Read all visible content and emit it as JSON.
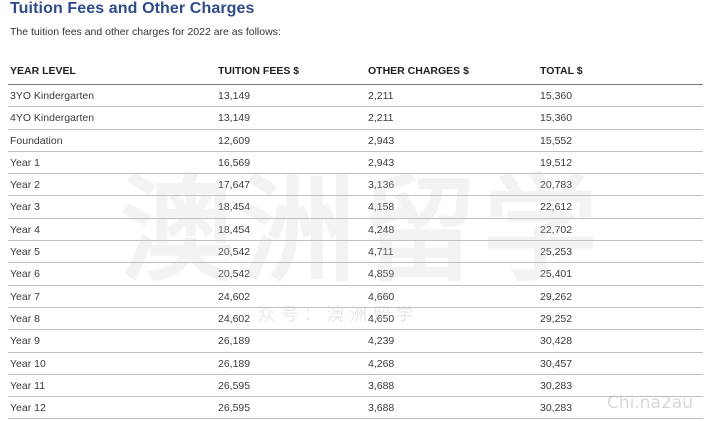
{
  "heading": {
    "title": "Tuition Fees and Other Charges",
    "intro": "The tuition fees and other charges for 2022 are as follows:"
  },
  "table": {
    "columns": [
      "YEAR LEVEL",
      "TUITION FEES $",
      "OTHER CHARGES $",
      "TOTAL $"
    ],
    "rows": [
      [
        "3YO Kindergarten",
        "13,149",
        "2,211",
        "15,360"
      ],
      [
        "4YO Kindergarten",
        "13,149",
        "2,211",
        "15,360"
      ],
      [
        "Foundation",
        "12,609",
        "2,943",
        "15,552"
      ],
      [
        "Year 1",
        "16,569",
        "2,943",
        "19,512"
      ],
      [
        "Year 2",
        "17,647",
        "3,136",
        "20,783"
      ],
      [
        "Year 3",
        "18,454",
        "4,158",
        "22,612"
      ],
      [
        "Year 4",
        "18,454",
        "4,248",
        "22,702"
      ],
      [
        "Year 5",
        "20,542",
        "4,711",
        "25,253"
      ],
      [
        "Year 6",
        "20,542",
        "4,859",
        "25,401"
      ],
      [
        "Year 7",
        "24,602",
        "4,660",
        "29,262"
      ],
      [
        "Year 8",
        "24,602",
        "4,650",
        "29,252"
      ],
      [
        "Year 9",
        "26,189",
        "4,239",
        "30,428"
      ],
      [
        "Year 10",
        "26,189",
        "4,268",
        "30,457"
      ],
      [
        "Year 11",
        "26,595",
        "3,688",
        "30,283"
      ],
      [
        "Year 12",
        "26,595",
        "3,688",
        "30,283"
      ]
    ]
  },
  "watermark": {
    "main": "澳洲留学",
    "sub": "众号：澳洲留学",
    "corner": "Chi.na2au"
  }
}
